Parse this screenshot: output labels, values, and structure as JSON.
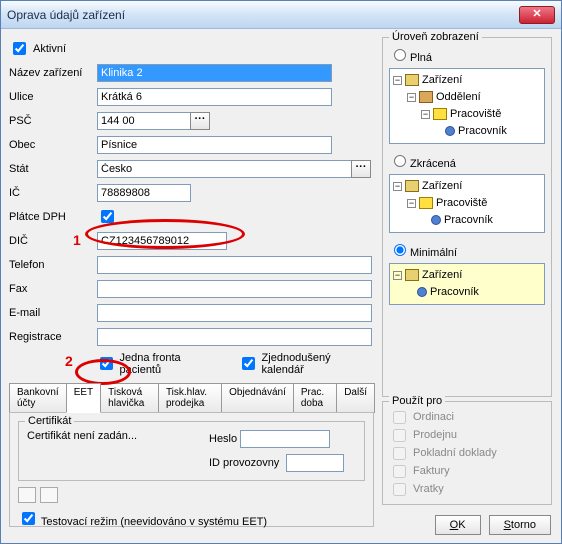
{
  "title": "Oprava údajů zařízení",
  "active": {
    "label": "Aktivní",
    "checked": true
  },
  "fields": {
    "nazev": {
      "label": "Název zařízení",
      "value": "Klinika 2"
    },
    "ulice": {
      "label": "Ulice",
      "value": "Krátká 6"
    },
    "psc": {
      "label": "PSČ",
      "value": "144 00"
    },
    "obec": {
      "label": "Obec",
      "value": "Písnice"
    },
    "stat": {
      "label": "Stát",
      "value": "Česko"
    },
    "ic": {
      "label": "IČ",
      "value": "78889808"
    },
    "platce": {
      "label": "Plátce DPH",
      "checked": true
    },
    "dic": {
      "label": "DIČ",
      "value": "CZ123456789012"
    },
    "telefon": {
      "label": "Telefon",
      "value": ""
    },
    "fax": {
      "label": "Fax",
      "value": ""
    },
    "email": {
      "label": "E-mail",
      "value": ""
    },
    "registrace": {
      "label": "Registrace",
      "value": ""
    }
  },
  "ann": {
    "n1": "1",
    "n2": "2"
  },
  "opts": {
    "fronta": {
      "label": "Jedna fronta pacientů",
      "checked": true
    },
    "kalendar": {
      "label": "Zjednodušený kalendář",
      "checked": true
    }
  },
  "tabs": [
    "Bankovní účty",
    "EET",
    "Tisková hlavička",
    "Tisk.hlav. prodejka",
    "Objednávání",
    "Prac. doba",
    "Další"
  ],
  "cert": {
    "group": "Certifikát",
    "none": "Certifikát není zadán...",
    "heslo": "Heslo",
    "idprov": "ID provozovny",
    "test": "Testovací režim (neevidováno v systému EET)",
    "testChecked": true
  },
  "uroven": {
    "title": "Úroveň zobrazení",
    "plna": "Plná",
    "zkracena": "Zkrácená",
    "minimalni": "Minimální",
    "sel": "minimalni",
    "tree": {
      "zarizeni": "Zařízení",
      "oddeleni": "Oddělení",
      "pracoviste": "Pracoviště",
      "pracovnik": "Pracovník"
    }
  },
  "pouzit": {
    "title": "Použít pro",
    "items": [
      "Ordinaci",
      "Prodejnu",
      "Pokladní doklady",
      "Faktury",
      "Vratky"
    ]
  },
  "buttons": {
    "ok": "OK",
    "storno": "Storno"
  }
}
